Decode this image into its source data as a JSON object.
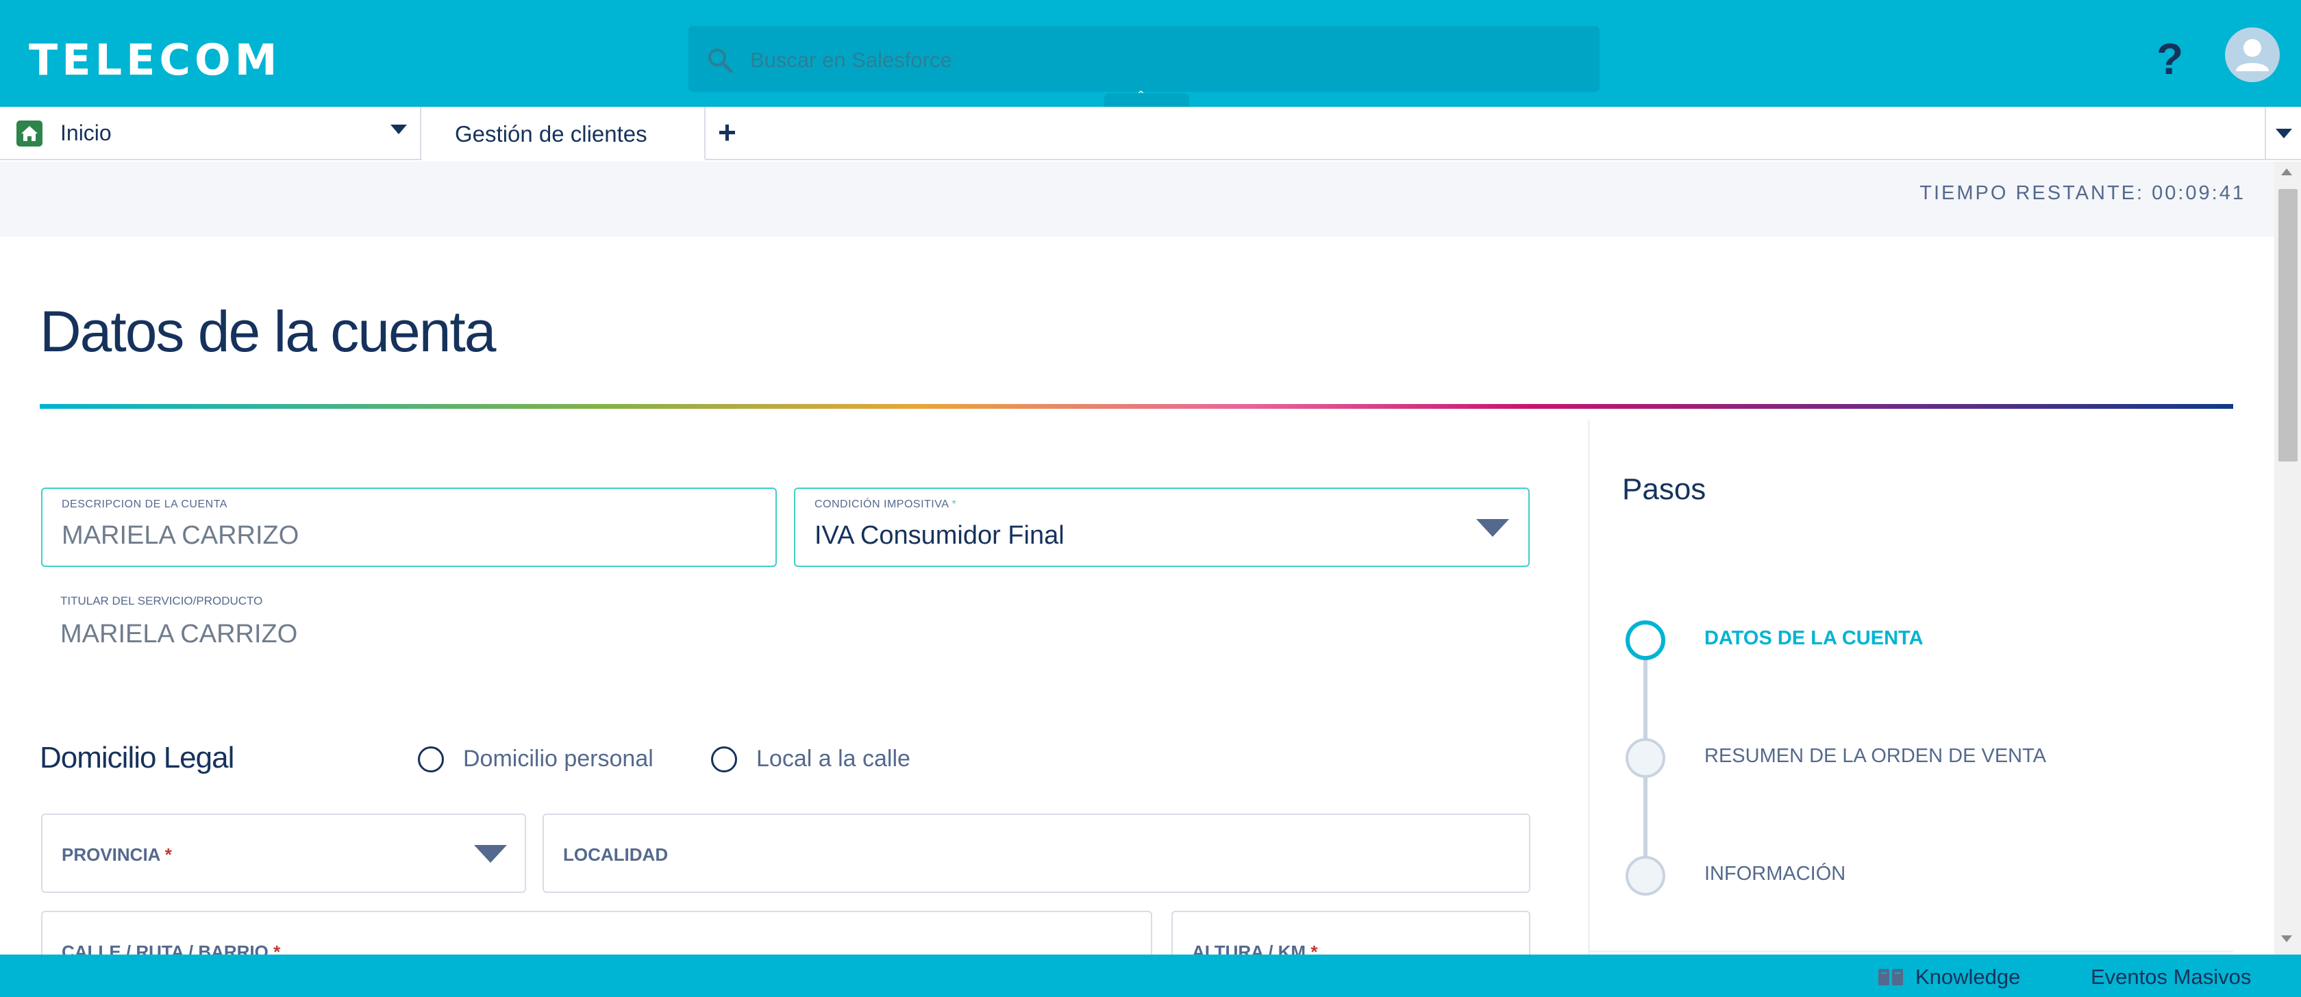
{
  "header": {
    "logo": "TELECOM",
    "search_placeholder": "Buscar en Salesforce",
    "collapse_glyph": "ˆ",
    "help_glyph": "?",
    "icons": {
      "search": "search-icon",
      "avatar": "user-avatar-icon"
    }
  },
  "tabs": {
    "home_label": "Inicio",
    "active_label": "Gestión de clientes",
    "add_glyph": "+"
  },
  "timer": "TIEMPO RESTANTE: 00:09:41",
  "page_title": "Datos de la cuenta",
  "form": {
    "account_description": {
      "label": "DESCRIPCION DE LA CUENTA",
      "value": "MARIELA CARRIZO"
    },
    "tax_condition": {
      "label": "CONDICIÓN IMPOSITIVA",
      "required_mark": "*",
      "value": "IVA Consumidor Final"
    },
    "service_holder": {
      "label": "TITULAR DEL SERVICIO/PRODUCTO",
      "value": "MARIELA CARRIZO"
    },
    "section_title": "Domicilio Legal",
    "radio_personal": "Domicilio personal",
    "radio_local": "Local a la calle",
    "provincia": {
      "label": "PROVINCIA",
      "required_mark": "*"
    },
    "localidad": {
      "label": "LOCALIDAD"
    },
    "calle": {
      "label": "CALLE / RUTA / BARRIO",
      "required_mark": "*"
    },
    "altura": {
      "label": "ALTURA / KM",
      "required_mark": "*"
    }
  },
  "steps": {
    "title": "Pasos",
    "items": [
      {
        "label": "DATOS DE LA CUENTA",
        "state": "current"
      },
      {
        "label": "RESUMEN DE LA ORDEN DE VENTA",
        "state": "pending"
      },
      {
        "label": "INFORMACIÓN",
        "state": "pending"
      }
    ]
  },
  "footer": {
    "knowledge": "Knowledge",
    "eventos": "Eventos Masivos"
  },
  "colors": {
    "brand": "#00b4d3",
    "text_dark": "#16325c",
    "field_active_border": "#3fd1c6",
    "required": "#c23934"
  }
}
